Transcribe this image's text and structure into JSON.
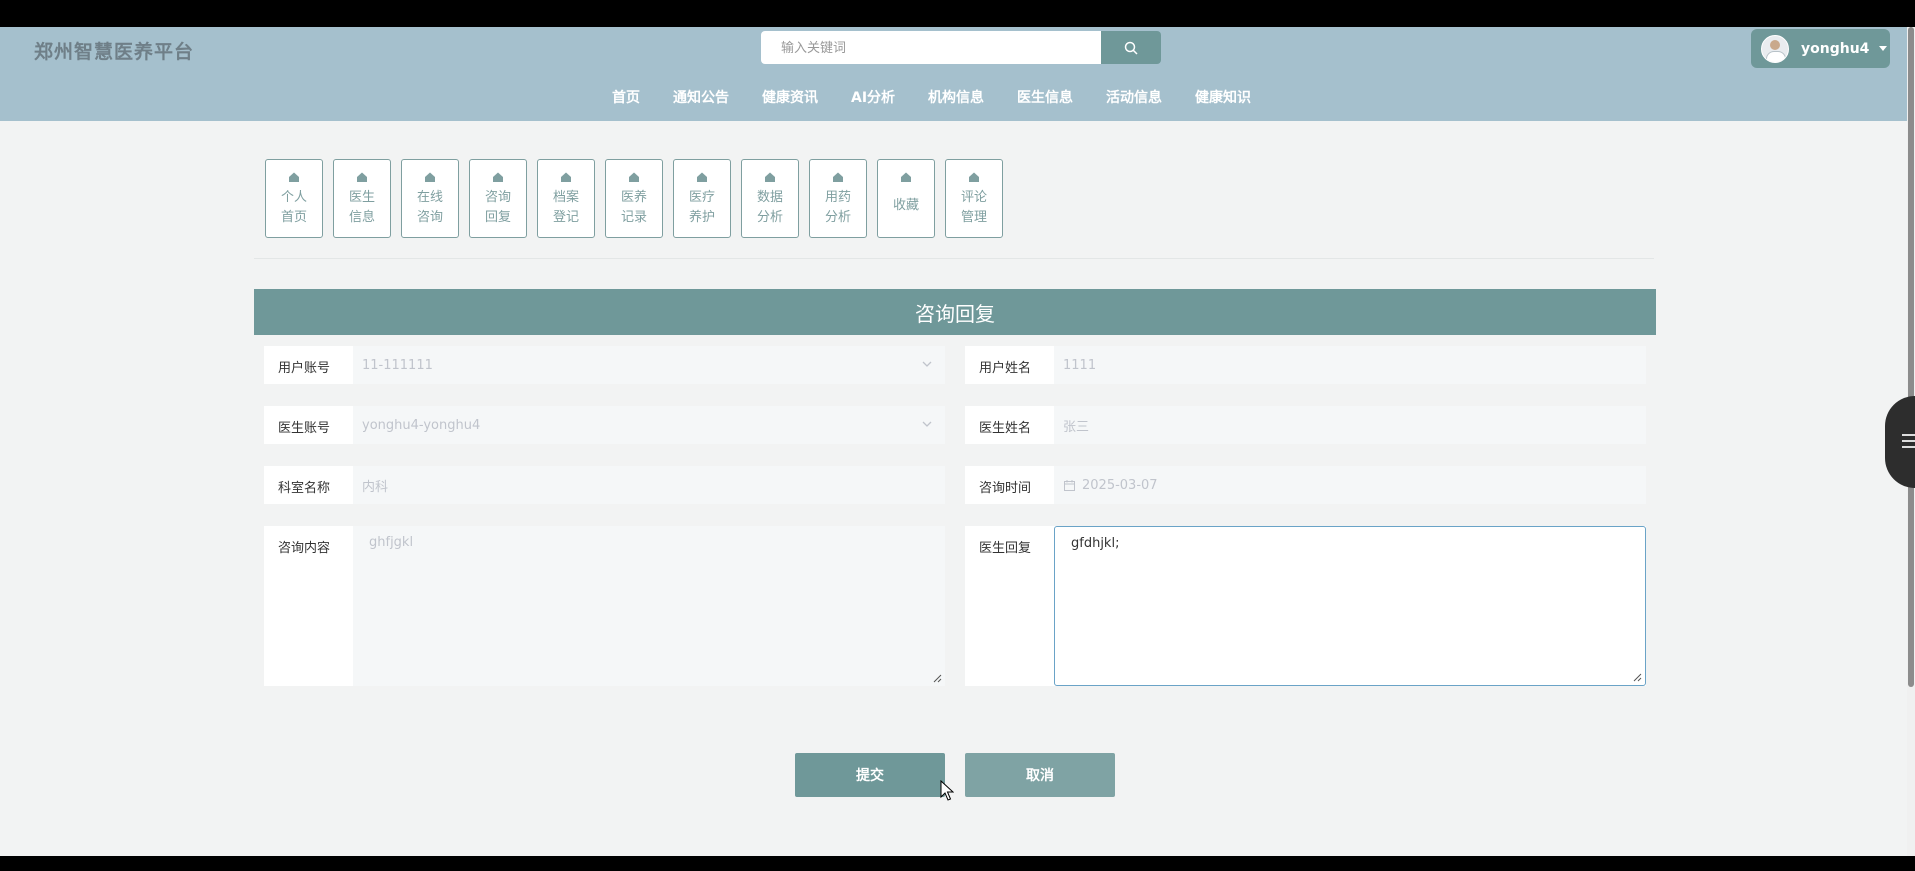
{
  "header": {
    "brand": "郑州智慧医养平台",
    "search_placeholder": "输入关键词",
    "user_name": "yonghu4",
    "nav": [
      "首页",
      "通知公告",
      "健康资讯",
      "AI分析",
      "机构信息",
      "医生信息",
      "活动信息",
      "健康知识"
    ]
  },
  "menu": [
    {
      "label": "个人首页"
    },
    {
      "label": "医生信息"
    },
    {
      "label": "在线咨询"
    },
    {
      "label": "咨询回复"
    },
    {
      "label": "档案登记"
    },
    {
      "label": "医养记录"
    },
    {
      "label": "医疗养护"
    },
    {
      "label": "数据分析"
    },
    {
      "label": "用药分析"
    },
    {
      "label": "收藏"
    },
    {
      "label": "评论管理"
    }
  ],
  "form": {
    "title": "咨询回复",
    "user_account": {
      "label": "用户账号",
      "value": "11-111111"
    },
    "user_name": {
      "label": "用户姓名",
      "value": "1111"
    },
    "doctor_account": {
      "label": "医生账号",
      "value": "yonghu4-yonghu4"
    },
    "doctor_name": {
      "label": "医生姓名",
      "value": "张三"
    },
    "department": {
      "label": "科室名称",
      "value": "内科"
    },
    "consult_time": {
      "label": "咨询时间",
      "value": "2025-03-07"
    },
    "consult_content": {
      "label": "咨询内容",
      "value": "ghfjgkl"
    },
    "doctor_reply": {
      "label": "医生回复",
      "value": "gfdhjkl;"
    },
    "submit_label": "提交",
    "cancel_label": "取消"
  },
  "colors": {
    "header_bg": "#a5c0cd",
    "accent": "#6f9899"
  }
}
